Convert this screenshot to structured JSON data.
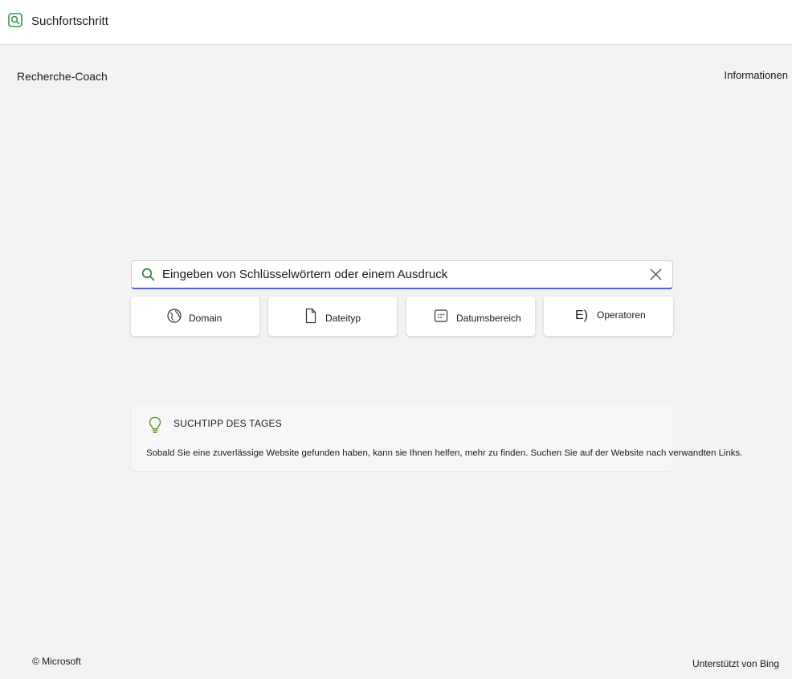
{
  "app": {
    "title": "Suchfortschritt",
    "icon": "search-icon",
    "accent_color": "#2e9e49"
  },
  "header": {
    "left_label": "Recherche-Coach",
    "right_label": "Informationen"
  },
  "search": {
    "placeholder": "Eingeben von Schlüsselwörtern oder einem Ausdruck",
    "value": "",
    "focus_color": "#5b5fc7"
  },
  "filters": [
    {
      "label": "Domain",
      "icon": "globe-icon"
    },
    {
      "label": "Dateityp",
      "icon": "document-icon"
    },
    {
      "label": "Datumsbereich",
      "icon": "calendar-icon"
    },
    {
      "label": "Operatoren",
      "icon_text": "E)",
      "icon": "operators-icon"
    }
  ],
  "tip": {
    "icon": "lightbulb-icon",
    "heading": "SUCHTIPP DES TAGES",
    "text": "Sobald Sie eine zuverlässige Website gefunden haben, kann sie Ihnen helfen, mehr zu finden. Suchen Sie auf der Website nach verwandten Links."
  },
  "footer": {
    "left": "© Microsoft",
    "right": "Unterstützt von Bing"
  }
}
